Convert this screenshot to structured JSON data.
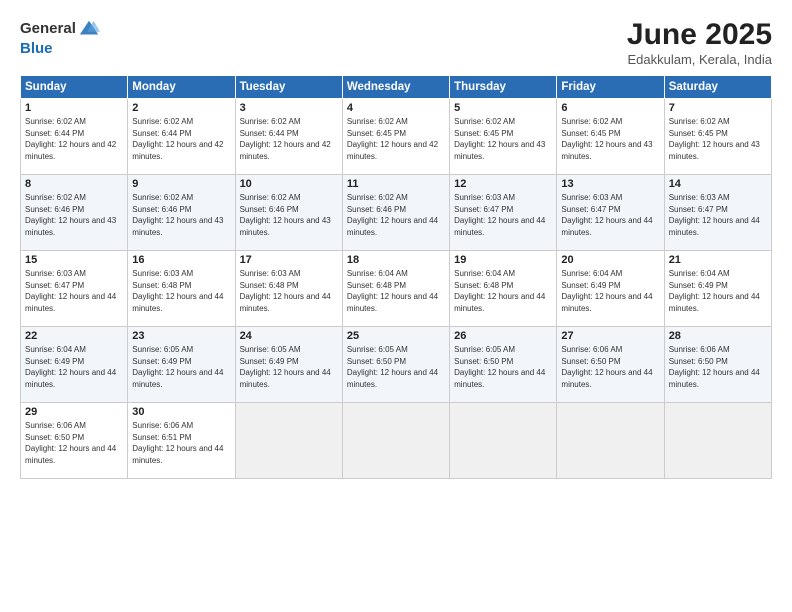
{
  "header": {
    "logo_general": "General",
    "logo_blue": "Blue",
    "title": "June 2025",
    "subtitle": "Edakkulam, Kerala, India"
  },
  "weekdays": [
    "Sunday",
    "Monday",
    "Tuesday",
    "Wednesday",
    "Thursday",
    "Friday",
    "Saturday"
  ],
  "weeks": [
    [
      {
        "day": "1",
        "sunrise": "6:02 AM",
        "sunset": "6:44 PM",
        "daylight": "12 hours and 42 minutes."
      },
      {
        "day": "2",
        "sunrise": "6:02 AM",
        "sunset": "6:44 PM",
        "daylight": "12 hours and 42 minutes."
      },
      {
        "day": "3",
        "sunrise": "6:02 AM",
        "sunset": "6:44 PM",
        "daylight": "12 hours and 42 minutes."
      },
      {
        "day": "4",
        "sunrise": "6:02 AM",
        "sunset": "6:45 PM",
        "daylight": "12 hours and 42 minutes."
      },
      {
        "day": "5",
        "sunrise": "6:02 AM",
        "sunset": "6:45 PM",
        "daylight": "12 hours and 43 minutes."
      },
      {
        "day": "6",
        "sunrise": "6:02 AM",
        "sunset": "6:45 PM",
        "daylight": "12 hours and 43 minutes."
      },
      {
        "day": "7",
        "sunrise": "6:02 AM",
        "sunset": "6:45 PM",
        "daylight": "12 hours and 43 minutes."
      }
    ],
    [
      {
        "day": "8",
        "sunrise": "6:02 AM",
        "sunset": "6:46 PM",
        "daylight": "12 hours and 43 minutes."
      },
      {
        "day": "9",
        "sunrise": "6:02 AM",
        "sunset": "6:46 PM",
        "daylight": "12 hours and 43 minutes."
      },
      {
        "day": "10",
        "sunrise": "6:02 AM",
        "sunset": "6:46 PM",
        "daylight": "12 hours and 43 minutes."
      },
      {
        "day": "11",
        "sunrise": "6:02 AM",
        "sunset": "6:46 PM",
        "daylight": "12 hours and 44 minutes."
      },
      {
        "day": "12",
        "sunrise": "6:03 AM",
        "sunset": "6:47 PM",
        "daylight": "12 hours and 44 minutes."
      },
      {
        "day": "13",
        "sunrise": "6:03 AM",
        "sunset": "6:47 PM",
        "daylight": "12 hours and 44 minutes."
      },
      {
        "day": "14",
        "sunrise": "6:03 AM",
        "sunset": "6:47 PM",
        "daylight": "12 hours and 44 minutes."
      }
    ],
    [
      {
        "day": "15",
        "sunrise": "6:03 AM",
        "sunset": "6:47 PM",
        "daylight": "12 hours and 44 minutes."
      },
      {
        "day": "16",
        "sunrise": "6:03 AM",
        "sunset": "6:48 PM",
        "daylight": "12 hours and 44 minutes."
      },
      {
        "day": "17",
        "sunrise": "6:03 AM",
        "sunset": "6:48 PM",
        "daylight": "12 hours and 44 minutes."
      },
      {
        "day": "18",
        "sunrise": "6:04 AM",
        "sunset": "6:48 PM",
        "daylight": "12 hours and 44 minutes."
      },
      {
        "day": "19",
        "sunrise": "6:04 AM",
        "sunset": "6:48 PM",
        "daylight": "12 hours and 44 minutes."
      },
      {
        "day": "20",
        "sunrise": "6:04 AM",
        "sunset": "6:49 PM",
        "daylight": "12 hours and 44 minutes."
      },
      {
        "day": "21",
        "sunrise": "6:04 AM",
        "sunset": "6:49 PM",
        "daylight": "12 hours and 44 minutes."
      }
    ],
    [
      {
        "day": "22",
        "sunrise": "6:04 AM",
        "sunset": "6:49 PM",
        "daylight": "12 hours and 44 minutes."
      },
      {
        "day": "23",
        "sunrise": "6:05 AM",
        "sunset": "6:49 PM",
        "daylight": "12 hours and 44 minutes."
      },
      {
        "day": "24",
        "sunrise": "6:05 AM",
        "sunset": "6:49 PM",
        "daylight": "12 hours and 44 minutes."
      },
      {
        "day": "25",
        "sunrise": "6:05 AM",
        "sunset": "6:50 PM",
        "daylight": "12 hours and 44 minutes."
      },
      {
        "day": "26",
        "sunrise": "6:05 AM",
        "sunset": "6:50 PM",
        "daylight": "12 hours and 44 minutes."
      },
      {
        "day": "27",
        "sunrise": "6:06 AM",
        "sunset": "6:50 PM",
        "daylight": "12 hours and 44 minutes."
      },
      {
        "day": "28",
        "sunrise": "6:06 AM",
        "sunset": "6:50 PM",
        "daylight": "12 hours and 44 minutes."
      }
    ],
    [
      {
        "day": "29",
        "sunrise": "6:06 AM",
        "sunset": "6:50 PM",
        "daylight": "12 hours and 44 minutes."
      },
      {
        "day": "30",
        "sunrise": "6:06 AM",
        "sunset": "6:51 PM",
        "daylight": "12 hours and 44 minutes."
      },
      {
        "day": "",
        "sunrise": "",
        "sunset": "",
        "daylight": ""
      },
      {
        "day": "",
        "sunrise": "",
        "sunset": "",
        "daylight": ""
      },
      {
        "day": "",
        "sunrise": "",
        "sunset": "",
        "daylight": ""
      },
      {
        "day": "",
        "sunrise": "",
        "sunset": "",
        "daylight": ""
      },
      {
        "day": "",
        "sunrise": "",
        "sunset": "",
        "daylight": ""
      }
    ]
  ]
}
